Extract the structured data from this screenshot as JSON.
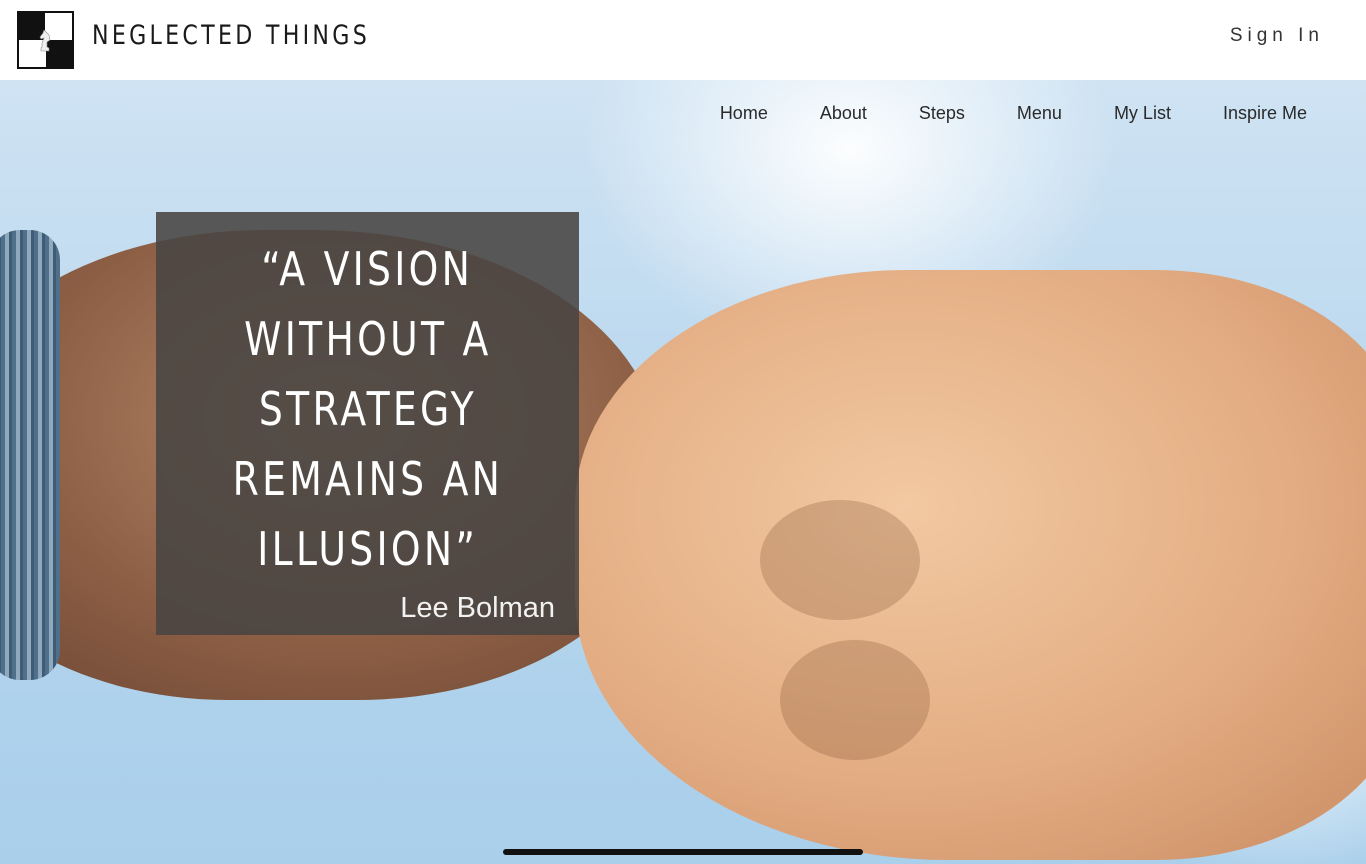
{
  "header": {
    "brand": "NEGLECTED THINGS",
    "logo_icon": "chess-knight-icon",
    "sign_in_label": "Sign In"
  },
  "nav": {
    "items": [
      {
        "label": "Home"
      },
      {
        "label": "About"
      },
      {
        "label": "Steps"
      },
      {
        "label": "Menu"
      },
      {
        "label": "My List"
      },
      {
        "label": "Inspire Me"
      }
    ]
  },
  "hero": {
    "quote_lines": [
      "“A VISION",
      "WITHOUT A",
      "STRATEGY",
      "REMAINS AN",
      "ILLUSION”"
    ],
    "author": "Lee Bolman"
  }
}
